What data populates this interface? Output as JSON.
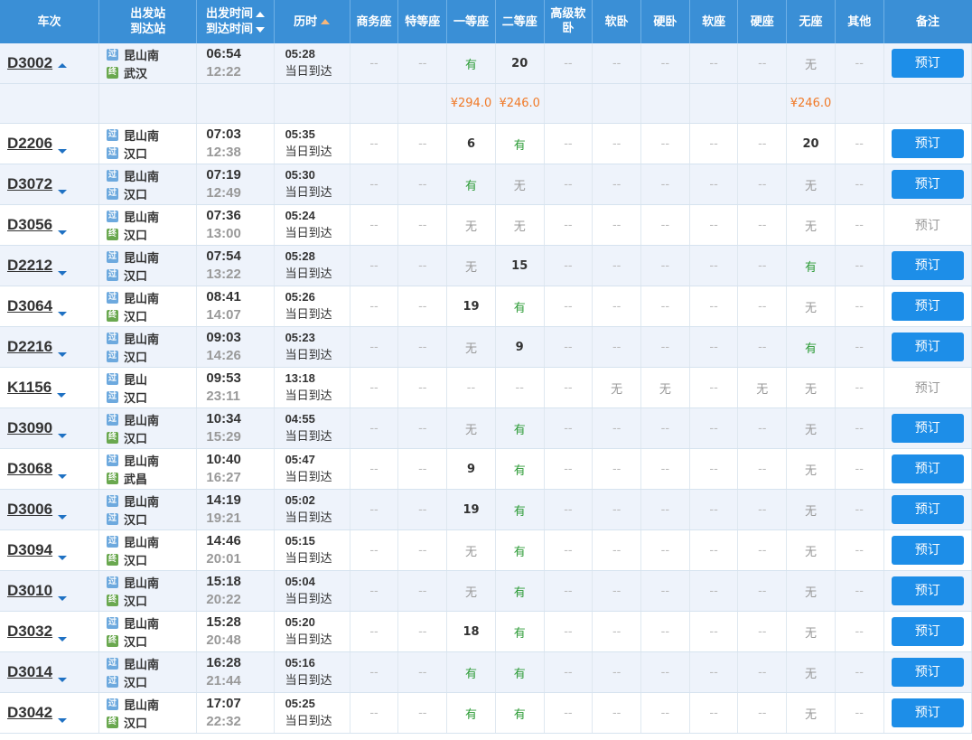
{
  "header": {
    "train_no": "车次",
    "dep_station": "出发站",
    "arr_station": "到达站",
    "dep_time": "出发时间",
    "arr_time": "到达时间",
    "duration": "历时",
    "seat_types": [
      "商务座",
      "特等座",
      "一等座",
      "二等座",
      "高级软卧",
      "软卧",
      "硬卧",
      "软座",
      "硬座",
      "无座",
      "其他"
    ],
    "remark": "备注"
  },
  "icons": {
    "pass": "过",
    "end": "终"
  },
  "colors": {
    "header_bg": "#3a8fd6",
    "book_button": "#1d8ee8",
    "available": "#2c9b36",
    "price": "#f07a28",
    "alt_row": "#eef3fb"
  },
  "trains": [
    {
      "no": "D3002",
      "expanded": true,
      "from": "昆山南",
      "from_icon": "pass",
      "to": "武汉",
      "to_icon": "end",
      "dep": "06:54",
      "arr": "12:22",
      "dur": "05:28",
      "day": "当日到达",
      "seats": [
        "--",
        "--",
        "有",
        "20",
        "--",
        "--",
        "--",
        "--",
        "--",
        "无",
        "--"
      ],
      "book": "预订",
      "book_enabled": true
    },
    {
      "no": "D2206",
      "expanded": false,
      "from": "昆山南",
      "from_icon": "pass",
      "to": "汉口",
      "to_icon": "pass",
      "dep": "07:03",
      "arr": "12:38",
      "dur": "05:35",
      "day": "当日到达",
      "seats": [
        "--",
        "--",
        "6",
        "有",
        "--",
        "--",
        "--",
        "--",
        "--",
        "20",
        "--"
      ],
      "book": "预订",
      "book_enabled": true
    },
    {
      "no": "D3072",
      "expanded": false,
      "from": "昆山南",
      "from_icon": "pass",
      "to": "汉口",
      "to_icon": "pass",
      "dep": "07:19",
      "arr": "12:49",
      "dur": "05:30",
      "day": "当日到达",
      "seats": [
        "--",
        "--",
        "有",
        "无",
        "--",
        "--",
        "--",
        "--",
        "--",
        "无",
        "--"
      ],
      "book": "预订",
      "book_enabled": true
    },
    {
      "no": "D3056",
      "expanded": false,
      "from": "昆山南",
      "from_icon": "pass",
      "to": "汉口",
      "to_icon": "end",
      "dep": "07:36",
      "arr": "13:00",
      "dur": "05:24",
      "day": "当日到达",
      "seats": [
        "--",
        "--",
        "无",
        "无",
        "--",
        "--",
        "--",
        "--",
        "--",
        "无",
        "--"
      ],
      "book": "预订",
      "book_enabled": false
    },
    {
      "no": "D2212",
      "expanded": false,
      "from": "昆山南",
      "from_icon": "pass",
      "to": "汉口",
      "to_icon": "pass",
      "dep": "07:54",
      "arr": "13:22",
      "dur": "05:28",
      "day": "当日到达",
      "seats": [
        "--",
        "--",
        "无",
        "15",
        "--",
        "--",
        "--",
        "--",
        "--",
        "有",
        "--"
      ],
      "book": "预订",
      "book_enabled": true
    },
    {
      "no": "D3064",
      "expanded": false,
      "from": "昆山南",
      "from_icon": "pass",
      "to": "汉口",
      "to_icon": "end",
      "dep": "08:41",
      "arr": "14:07",
      "dur": "05:26",
      "day": "当日到达",
      "seats": [
        "--",
        "--",
        "19",
        "有",
        "--",
        "--",
        "--",
        "--",
        "--",
        "无",
        "--"
      ],
      "book": "预订",
      "book_enabled": true
    },
    {
      "no": "D2216",
      "expanded": false,
      "from": "昆山南",
      "from_icon": "pass",
      "to": "汉口",
      "to_icon": "pass",
      "dep": "09:03",
      "arr": "14:26",
      "dur": "05:23",
      "day": "当日到达",
      "seats": [
        "--",
        "--",
        "无",
        "9",
        "--",
        "--",
        "--",
        "--",
        "--",
        "有",
        "--"
      ],
      "book": "预订",
      "book_enabled": true
    },
    {
      "no": "K1156",
      "expanded": false,
      "from": "昆山",
      "from_icon": "pass",
      "to": "汉口",
      "to_icon": "pass",
      "dep": "09:53",
      "arr": "23:11",
      "dur": "13:18",
      "day": "当日到达",
      "seats": [
        "--",
        "--",
        "--",
        "--",
        "--",
        "无",
        "无",
        "--",
        "无",
        "无",
        "--"
      ],
      "book": "预订",
      "book_enabled": false
    },
    {
      "no": "D3090",
      "expanded": false,
      "from": "昆山南",
      "from_icon": "pass",
      "to": "汉口",
      "to_icon": "end",
      "dep": "10:34",
      "arr": "15:29",
      "dur": "04:55",
      "day": "当日到达",
      "seats": [
        "--",
        "--",
        "无",
        "有",
        "--",
        "--",
        "--",
        "--",
        "--",
        "无",
        "--"
      ],
      "book": "预订",
      "book_enabled": true
    },
    {
      "no": "D3068",
      "expanded": false,
      "from": "昆山南",
      "from_icon": "pass",
      "to": "武昌",
      "to_icon": "end",
      "dep": "10:40",
      "arr": "16:27",
      "dur": "05:47",
      "day": "当日到达",
      "seats": [
        "--",
        "--",
        "9",
        "有",
        "--",
        "--",
        "--",
        "--",
        "--",
        "无",
        "--"
      ],
      "book": "预订",
      "book_enabled": true
    },
    {
      "no": "D3006",
      "expanded": false,
      "from": "昆山南",
      "from_icon": "pass",
      "to": "汉口",
      "to_icon": "pass",
      "dep": "14:19",
      "arr": "19:21",
      "dur": "05:02",
      "day": "当日到达",
      "seats": [
        "--",
        "--",
        "19",
        "有",
        "--",
        "--",
        "--",
        "--",
        "--",
        "无",
        "--"
      ],
      "book": "预订",
      "book_enabled": true
    },
    {
      "no": "D3094",
      "expanded": false,
      "from": "昆山南",
      "from_icon": "pass",
      "to": "汉口",
      "to_icon": "end",
      "dep": "14:46",
      "arr": "20:01",
      "dur": "05:15",
      "day": "当日到达",
      "seats": [
        "--",
        "--",
        "无",
        "有",
        "--",
        "--",
        "--",
        "--",
        "--",
        "无",
        "--"
      ],
      "book": "预订",
      "book_enabled": true
    },
    {
      "no": "D3010",
      "expanded": false,
      "from": "昆山南",
      "from_icon": "pass",
      "to": "汉口",
      "to_icon": "end",
      "dep": "15:18",
      "arr": "20:22",
      "dur": "05:04",
      "day": "当日到达",
      "seats": [
        "--",
        "--",
        "无",
        "有",
        "--",
        "--",
        "--",
        "--",
        "--",
        "无",
        "--"
      ],
      "book": "预订",
      "book_enabled": true
    },
    {
      "no": "D3032",
      "expanded": false,
      "from": "昆山南",
      "from_icon": "pass",
      "to": "汉口",
      "to_icon": "end",
      "dep": "15:28",
      "arr": "20:48",
      "dur": "05:20",
      "day": "当日到达",
      "seats": [
        "--",
        "--",
        "18",
        "有",
        "--",
        "--",
        "--",
        "--",
        "--",
        "无",
        "--"
      ],
      "book": "预订",
      "book_enabled": true
    },
    {
      "no": "D3014",
      "expanded": false,
      "from": "昆山南",
      "from_icon": "pass",
      "to": "汉口",
      "to_icon": "pass",
      "dep": "16:28",
      "arr": "21:44",
      "dur": "05:16",
      "day": "当日到达",
      "seats": [
        "--",
        "--",
        "有",
        "有",
        "--",
        "--",
        "--",
        "--",
        "--",
        "无",
        "--"
      ],
      "book": "预订",
      "book_enabled": true
    },
    {
      "no": "D3042",
      "expanded": false,
      "from": "昆山南",
      "from_icon": "pass",
      "to": "汉口",
      "to_icon": "end",
      "dep": "17:07",
      "arr": "22:32",
      "dur": "05:25",
      "day": "当日到达",
      "seats": [
        "--",
        "--",
        "有",
        "有",
        "--",
        "--",
        "--",
        "--",
        "--",
        "无",
        "--"
      ],
      "book": "预订",
      "book_enabled": true
    }
  ],
  "price_row": {
    "after": "D3002",
    "prices": [
      "",
      "",
      "¥294.0",
      "¥246.0",
      "",
      "",
      "",
      "",
      "",
      "¥246.0",
      ""
    ]
  }
}
